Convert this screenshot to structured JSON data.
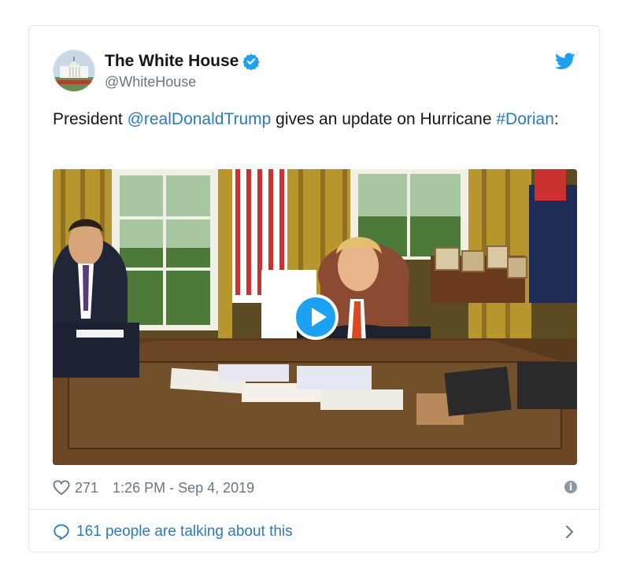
{
  "tweet": {
    "author_name": "The White House",
    "handle": "@WhiteHouse",
    "text_prefix": "President ",
    "mention": "@realDonaldTrump",
    "text_middle": " gives an update on Hurricane ",
    "hashtag": "#Dorian",
    "text_suffix": ":",
    "likes": "271",
    "timestamp": "1:26 PM - Sep 4, 2019",
    "talking_text": "161 people are talking about this",
    "info_glyph": "i"
  },
  "icons": {
    "verified": "verified-badge-icon",
    "bird": "twitter-bird-icon",
    "heart": "heart-icon",
    "play": "play-icon",
    "info": "info-icon",
    "bubble": "speech-bubble-icon",
    "chevron": "chevron-right-icon"
  },
  "colors": {
    "brand_blue": "#1da1f2",
    "link_blue": "#2b7bb9",
    "text": "#14171a",
    "muted": "#657786",
    "border": "#e1e8ed"
  }
}
